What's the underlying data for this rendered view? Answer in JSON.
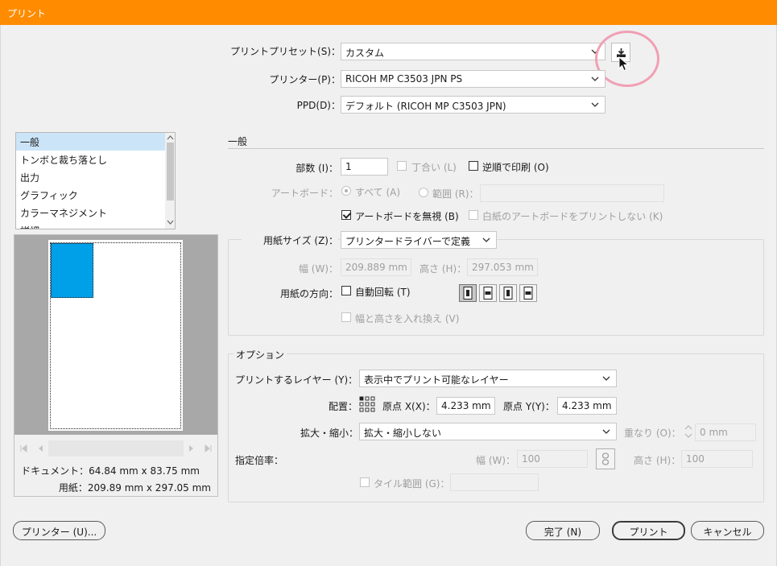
{
  "window": {
    "title": "プリント"
  },
  "preset": {
    "label": "プリントプリセット(S)：",
    "value": "カスタム",
    "printer_label": "プリンター(P)：",
    "printer_value": "RICOH MP C3503 JPN PS",
    "ppd_label": "PPD(D)：",
    "ppd_value": "デフォルト (RICOH MP C3503 JPN)"
  },
  "sidebar": {
    "items": [
      {
        "label": "一般"
      },
      {
        "label": "トンボと裁ち落とし"
      },
      {
        "label": "出力"
      },
      {
        "label": "グラフィック"
      },
      {
        "label": "カラーマネジメント"
      },
      {
        "label": "詳細"
      }
    ],
    "document_info": "ドキュメント：64.84 mm x 83.75 mm",
    "paper_info": "用紙：209.89 mm x 297.05 mm"
  },
  "general": {
    "heading": "一般",
    "copies_label": "部数 (I)：",
    "copies_value": "1",
    "collate_label": "丁合い (L)",
    "reverse_label": "逆順で印刷 (O)",
    "artboard_label": "アートボード：",
    "all_label": "すべて (A)",
    "range_label": "範囲 (R)：",
    "range_value": "",
    "ignore_artboard_label": "アートボードを無視 (B)",
    "skip_blank_label": "白紙のアートボードをプリントしない (K)"
  },
  "paper": {
    "size_label": "用紙サイズ (Z)：",
    "size_value": "プリンタードライバーで定義",
    "width_label": "幅 (W)：",
    "width_value": "209.889 mm",
    "height_label": "高さ (H)：",
    "height_value": "297.053 mm",
    "orientation_label": "用紙の方向：",
    "auto_rotate_label": "自動回転 (T)",
    "swap_label": "幅と高さを入れ換え (V)"
  },
  "options": {
    "heading": "オプション",
    "layers_label": "プリントするレイヤー (Y)：",
    "layers_value": "表示中でプリント可能なレイヤー",
    "placement_label": "配置：",
    "origin_x_label": "原点 X(X)：",
    "origin_x_value": "4.233 mm",
    "origin_y_label": "原点 Y(Y)：",
    "origin_y_value": "4.233 mm",
    "scaling_label": "拡大・縮小：",
    "scaling_value": "拡大・縮小しない",
    "overlap_label": "重なり (O)：",
    "overlap_value": "0 mm",
    "custom_scale_label": "指定倍率：",
    "scale_width_label": "幅 (W)：",
    "scale_width_value": "100",
    "scale_height_label": "高さ (H)：",
    "scale_height_value": "100",
    "tile_label": "タイル範囲 (G)："
  },
  "footer": {
    "printer_button": "プリンター (U)...",
    "done_button": "完了 (N)",
    "print_button": "プリント",
    "cancel_button": "キャンセル"
  },
  "colors": {
    "title_bar": "#ff8c00",
    "selection": "#cce4f7",
    "preview_artwork": "#00a0e9",
    "highlight_circle": "#f0a0b4"
  }
}
